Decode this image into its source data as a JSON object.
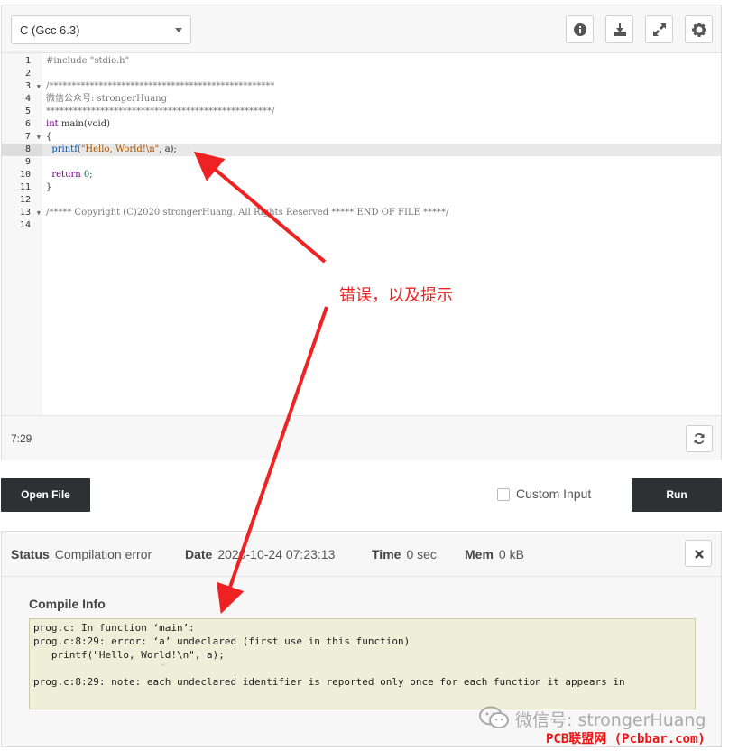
{
  "editor": {
    "language": "C (Gcc 6.3)",
    "toolbar_icons": [
      "info-icon",
      "download-icon",
      "expand-icon",
      "gear-icon"
    ],
    "line_numbers": [
      "1",
      "2",
      "3",
      "4",
      "5",
      "6",
      "7",
      "8",
      "9",
      "10",
      "11",
      "12",
      "13",
      "14"
    ],
    "code": {
      "l1": "#include \"stdio.h\"",
      "l3": "/**************************************************",
      "l4": "微信公众号: strongerHuang",
      "l5": "**************************************************/",
      "l6_kw": "int",
      "l6_rest": " main(void)",
      "l7": "{",
      "l8_fn": "  printf(",
      "l8_str": "\"Hello, World!\\n\"",
      "l8_rest": ", a);",
      "l10_kw": "  return",
      "l10_num": " 0",
      "l10_rest": ";",
      "l11": "}",
      "l13": "/***** Copyright (C)2020 strongerHuang. All Rights Reserved ***** END OF FILE *****/"
    },
    "cursor_position": "7:29"
  },
  "actions": {
    "open_file": "Open File",
    "custom_input": "Custom Input",
    "run": "Run"
  },
  "result": {
    "status_label": "Status",
    "status_value": "Compilation error",
    "date_label": "Date",
    "date_value": "2020-10-24 07:23:13",
    "time_label": "Time",
    "time_value": "0 sec",
    "mem_label": "Mem",
    "mem_value": "0 kB",
    "compile_title": "Compile Info",
    "compile_lines": [
      "prog.c: In function ‘main’:",
      "prog.c:8:29: error: ‘a’ undeclared (first use in this function)",
      "   printf(\"Hello, World!\\n\", a);",
      "",
      "prog.c:8:29: note: each undeclared identifier is reported only once for each function it appears in"
    ],
    "caret_line": "                          ^"
  },
  "annotation": {
    "note": "错误，以及提示",
    "color": "#ee2222"
  },
  "watermark": {
    "wechat": "微信号: strongerHuang",
    "site": "PCB联盟网 (Pcbbar.com)"
  }
}
